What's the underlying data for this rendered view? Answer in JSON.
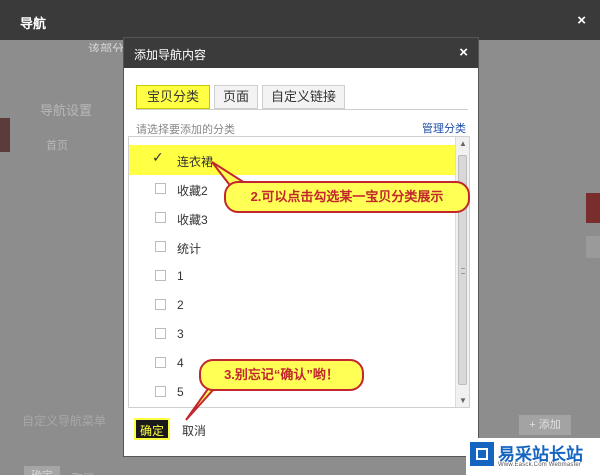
{
  "outer": {
    "title": "导航",
    "close": "×",
    "top_text": "该部分将在线上显示您的店名，照版，说明",
    "sidebar_title": "导航设置",
    "sidebar_item": "首页",
    "blur_text": "自定义导航菜单",
    "confirm": "确定",
    "cancel": "取消",
    "add_button": "+ 添加"
  },
  "dialog": {
    "title": "添加导航内容",
    "close": "×",
    "tabs": [
      {
        "label": "宝贝分类",
        "active": true
      },
      {
        "label": "页面",
        "active": false
      },
      {
        "label": "自定义链接",
        "active": false
      }
    ],
    "hint": "请选择要添加的分类",
    "manage_link": "管理分类",
    "items": [
      {
        "label": "连衣裙",
        "checked": true
      },
      {
        "label": "收藏2",
        "checked": false
      },
      {
        "label": "收藏3",
        "checked": false
      },
      {
        "label": "统计",
        "checked": false
      },
      {
        "label": "1",
        "checked": false
      },
      {
        "label": "2",
        "checked": false
      },
      {
        "label": "3",
        "checked": false
      },
      {
        "label": "4",
        "checked": false
      },
      {
        "label": "5",
        "checked": false
      }
    ],
    "check_mark": "✓",
    "scroll_up": "▲",
    "scroll_down": "▼",
    "confirm": "确定",
    "cancel": "取消"
  },
  "callouts": {
    "one": "2.可以点击勾选某一宝贝分类展示",
    "two": "3.别忘记“确认”哟！"
  },
  "watermark": {
    "title": "易采站长站",
    "subtitle": "Www.Easck.Com Webmaster"
  },
  "colors": {
    "highlight": "#ffff44",
    "callout_border": "#c1272d",
    "titlebar": "#3b3b3b",
    "link": "#1f4fa8",
    "brand": "#1565c0"
  }
}
